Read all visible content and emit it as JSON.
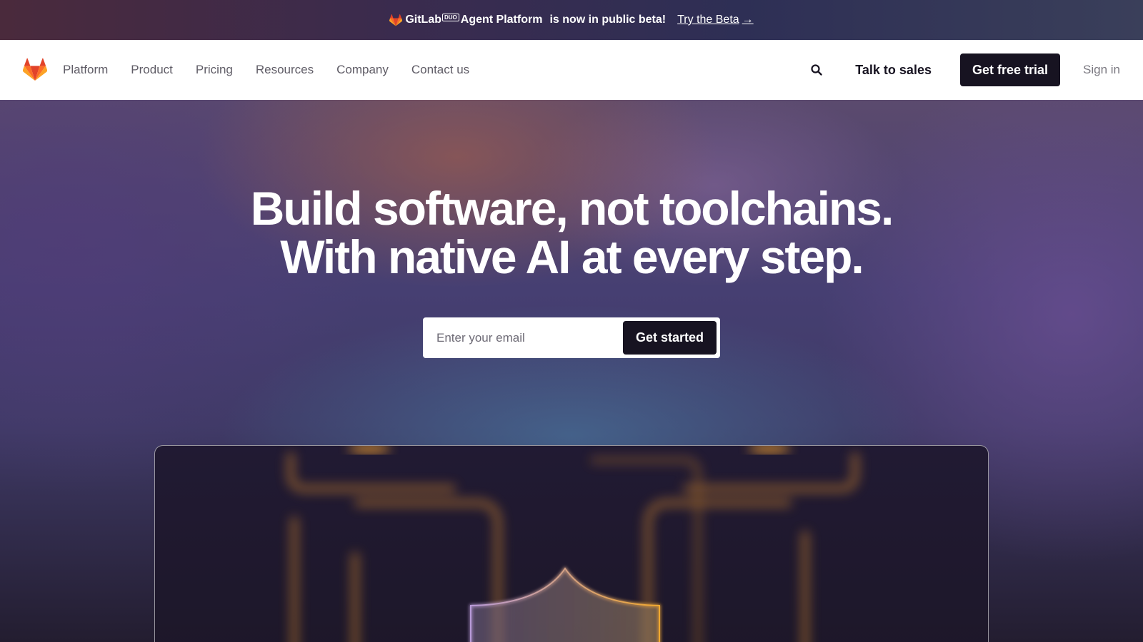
{
  "banner": {
    "brand_name": "GitLab",
    "brand_badge": "DUO",
    "product_name": "Agent Platform",
    "message": "is now in public beta!",
    "link_label": "Try the Beta",
    "link_arrow": "→"
  },
  "navbar": {
    "logo_icon": "gitlab-tanuki-logo",
    "links": [
      "Platform",
      "Product",
      "Pricing",
      "Resources",
      "Company",
      "Contact us"
    ],
    "search_icon": "search-icon",
    "talk_to_sales": "Talk to sales",
    "free_trial": "Get free trial",
    "sign_in": "Sign in"
  },
  "hero": {
    "title_line1": "Build software, not toolchains.",
    "title_line2": "With native AI at every step.",
    "email_placeholder": "Enter your email",
    "cta_label": "Get started"
  },
  "colors": {
    "brand_orange": "#fc6d26",
    "brand_orange_light": "#fca326",
    "brand_red": "#e24329",
    "dark_button": "#171321",
    "nav_text": "#5f5c66"
  }
}
